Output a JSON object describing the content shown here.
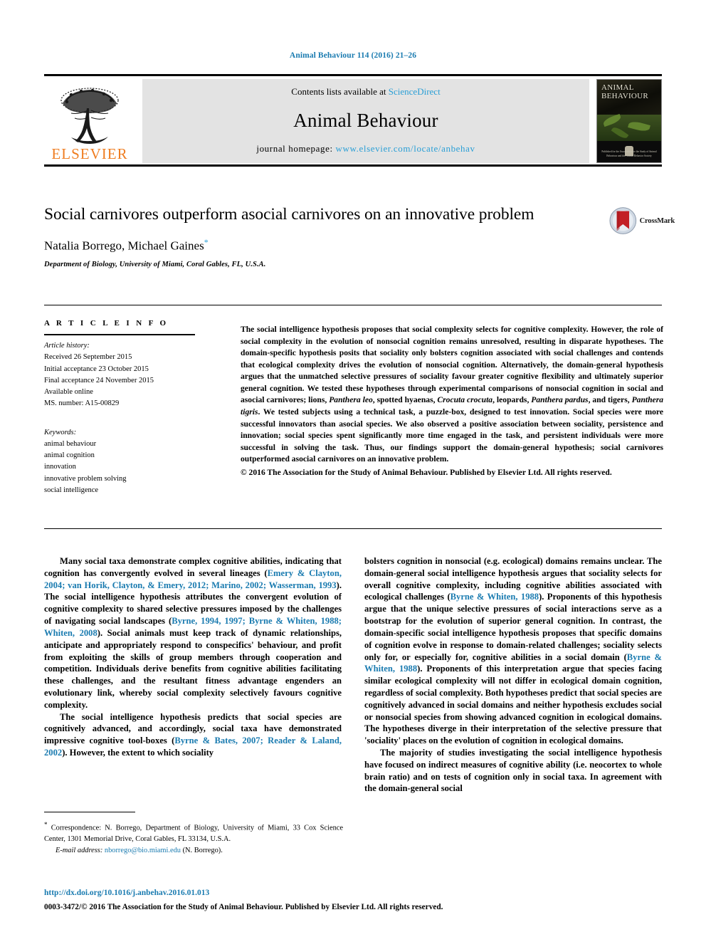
{
  "running_head": "Animal Behaviour 114 (2016) 21–26",
  "masthead": {
    "contents_prefix": "Contents lists available at ",
    "sciencedirect": "ScienceDirect",
    "journal_name": "Animal Behaviour",
    "homepage_label": "journal homepage: ",
    "homepage_url": "www.elsevier.com/locate/anbehav",
    "publisher_logo_text": "ELSEVIER",
    "cover_title": "ANIMAL BEHAVIOUR",
    "cover_caption": "Published for the Association for the Study of Animal Behaviour and the Animal Behavior Society"
  },
  "crossmark": {
    "label": "CrossMark"
  },
  "article": {
    "title": "Social carnivores outperform asocial carnivores on an innovative problem",
    "authors": "Natalia Borrego, Michael Gaines",
    "correspondence_marker": "*",
    "affiliation": "Department of Biology, University of Miami, Coral Gables, FL, U.S.A."
  },
  "article_info": {
    "heading": "A R T I C L E   I N F O",
    "history_label": "Article history:",
    "history": [
      "Received 26 September 2015",
      "Initial acceptance 23 October 2015",
      "Final acceptance 24 November 2015",
      "Available online",
      "MS. number: A15-00829"
    ],
    "keywords_label": "Keywords:",
    "keywords": [
      "animal behaviour",
      "animal cognition",
      "innovation",
      "innovative problem solving",
      "social intelligence"
    ]
  },
  "abstract": {
    "part1": "The social intelligence hypothesis proposes that social complexity selects for cognitive complexity. However, the role of social complexity in the evolution of nonsocial cognition remains unresolved, resulting in disparate hypotheses. The domain-specific hypothesis posits that sociality only bolsters cognition associated with social challenges and contends that ecological complexity drives the evolution of nonsocial cognition. Alternatively, the domain-general hypothesis argues that the unmatched selective pressures of sociality favour greater cognitive flexibility and ultimately superior general cognition. We tested these hypotheses through experimental comparisons of nonsocial cognition in social and asocial carnivores; lions, ",
    "sp1": "Panthera leo",
    "part2": ", spotted hyaenas, ",
    "sp2": "Crocuta crocuta",
    "part3": ", leopards, ",
    "sp3": "Panthera pardus",
    "part4": ", and tigers, ",
    "sp4": "Panthera tigris",
    "part5": ". We tested subjects using a technical task, a puzzle-box, designed to test innovation. Social species were more successful innovators than asocial species. We also observed a positive association between sociality, persistence and innovation; social species spent significantly more time engaged in the task, and persistent individuals were more successful in solving the task. Thus, our findings support the domain-general hypothesis; social carnivores outperformed asocial carnivores on an innovative problem.",
    "copyright": "© 2016 The Association for the Study of Animal Behaviour. Published by Elsevier Ltd. All rights reserved."
  },
  "body": {
    "left": {
      "p1_a": "Many social taxa demonstrate complex cognitive abilities, indicating that cognition has convergently evolved in several lineages (",
      "p1_ref1": "Emery & Clayton, 2004; van Horik, Clayton, & Emery, 2012; Marino, 2002; Wasserman, 1993",
      "p1_b": "). The social intelligence hypothesis attributes the convergent evolution of cognitive complexity to shared selective pressures imposed by the challenges of navigating social landscapes (",
      "p1_ref2": "Byrne, 1994, 1997; Byrne & Whiten, 1988; Whiten, 2008",
      "p1_c": "). Social animals must keep track of dynamic relationships, anticipate and appropriately respond to conspecifics' behaviour, and profit from exploiting the skills of group members through cooperation and competition. Individuals derive benefits from cognitive abilities facilitating these challenges, and the resultant fitness advantage engenders an evolutionary link, whereby social complexity selectively favours cognitive complexity.",
      "p2_a": "The social intelligence hypothesis predicts that social species are cognitively advanced, and accordingly, social taxa have demonstrated impressive cognitive tool-boxes (",
      "p2_ref1": "Byrne & Bates, 2007; Reader & Laland, 2002",
      "p2_b": "). However, the extent to which sociality"
    },
    "right": {
      "p1_a": "bolsters cognition in nonsocial (e.g. ecological) domains remains unclear. The domain-general social intelligence hypothesis argues that sociality selects for overall cognitive complexity, including cognitive abilities associated with ecological challenges (",
      "p1_ref1": "Byrne & Whiten, 1988",
      "p1_b": "). Proponents of this hypothesis argue that the unique selective pressures of social interactions serve as a bootstrap for the evolution of superior general cognition. In contrast, the domain-specific social intelligence hypothesis proposes that specific domains of cognition evolve in response to domain-related challenges; sociality selects only for, or especially for, cognitive abilities in a social domain (",
      "p1_ref2": "Byrne & Whiten, 1988",
      "p1_c": "). Proponents of this interpretation argue that species facing similar ecological complexity will not differ in ecological domain cognition, regardless of social complexity. Both hypotheses predict that social species are cognitively advanced in social domains and neither hypothesis excludes social or nonsocial species from showing advanced cognition in ecological domains. The hypotheses diverge in their interpretation of the selective pressure that 'sociality' places on the evolution of cognition in ecological domains.",
      "p2": "The majority of studies investigating the social intelligence hypothesis have focused on indirect measures of cognitive ability (i.e. neocortex to whole brain ratio) and on tests of cognition only in social taxa. In agreement with the domain-general social"
    }
  },
  "footnote": {
    "marker": "*",
    "correspondence": " Correspondence: N. Borrego, Department of Biology, University of Miami, 33 Cox Science Center, 1301 Memorial Drive, Coral Gables, FL 33134, U.S.A.",
    "email_label": "E-mail address: ",
    "email": "nborrego@bio.miami.edu",
    "email_suffix": " (N. Borrego)."
  },
  "bottom": {
    "doi": "http://dx.doi.org/10.1016/j.anbehav.2016.01.013",
    "issn": "0003-3472/© 2016 The Association for the Study of Animal Behaviour. Published by Elsevier Ltd. All rights reserved."
  },
  "colors": {
    "link_blue": "#1a7bb0",
    "sciencedirect_blue": "#2a9fd6",
    "elsevier_orange": "#ef7d21"
  }
}
